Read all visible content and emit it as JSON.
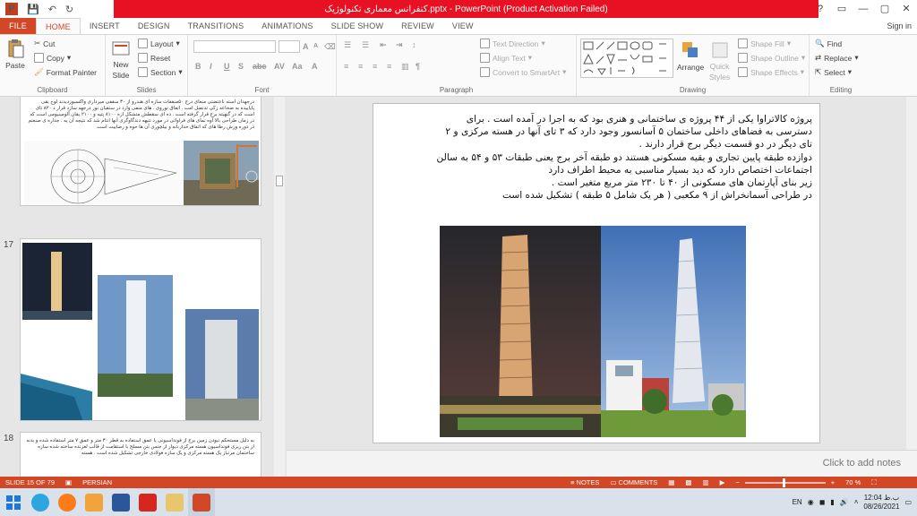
{
  "titlebar": {
    "title": "کنفرانس معماری تکنولوژیک.pptx - PowerPoint (Product Activation Failed)",
    "qat_save": "💾",
    "qat_undo": "↶",
    "qat_redo": "↻",
    "help": "?",
    "ribbon_opts": "▭",
    "minimize": "—",
    "maximize": "▢",
    "close": "✕"
  },
  "tabs": [
    "FILE",
    "HOME",
    "INSERT",
    "DESIGN",
    "TRANSITIONS",
    "ANIMATIONS",
    "SLIDE SHOW",
    "REVIEW",
    "VIEW"
  ],
  "signin": "Sign in",
  "ribbon": {
    "clipboard": {
      "label": "Clipboard",
      "paste": "Paste",
      "cut": "Cut",
      "copy": "Copy",
      "format_painter": "Format Painter"
    },
    "slides": {
      "label": "Slides",
      "new_slide": "New",
      "new_slide_2": "Slide",
      "layout": "Layout",
      "reset": "Reset",
      "section": "Section"
    },
    "font": {
      "label": "Font"
    },
    "paragraph": {
      "label": "Paragraph",
      "text_direction": "Text Direction",
      "align_text": "Align Text",
      "convert_smartart": "Convert to SmartArt"
    },
    "drawing": {
      "label": "Drawing",
      "arrange": "Arrange",
      "quick_styles": "Quick",
      "quick_styles_2": "Styles",
      "shape_fill": "Shape Fill",
      "shape_outline": "Shape Outline",
      "shape_effects": "Shape Effects"
    },
    "editing": {
      "label": "Editing",
      "find": "Find",
      "replace": "Replace",
      "select": "Select"
    }
  },
  "thumbs": {
    "slide16_text": "درجهدان استه ناعتضتی منعای درج ۵۰منقفات سازه ای هندرو از ۳۰ سقفی مبرداری واکسبوزدیدند لوح بقی پایاییده به ضخاعه زکی تدنضل امت . اتفاق توروی . های منفی وارد در ستقبان نور درجهه سازد قرار د ۸۲۰ تای است که در گنهبته برج قرار گرفته است . ده ای سقطش متشکل ازه ۸۱۰۰ پتیه و ۲۱۰۰ یقان آلومینیومی است که در زمان طراحی بالا آوه نمای های فراواتی در مورد تنبهه دندگاوگری آنها انتام شد که نتیجه آن یه . جداره ی صنعتم در دوره ورش رطا های که اتفاق حداربانه و بیلچوری آن ها حوه و رضاییت است",
    "slide17_num": "17",
    "slide18_num": "18",
    "slide18_text": "به دلیل مستحکم نبودن زمین برج از فونداسیونی با عمق استفاده به قطر ۳۰ متر و عمق ۷ متر استفاده شده و بدنه از بتن ریزی فونداسیون هسته مرکزی دیوار از جنس بتن مسلح با استقامت از قالب لغزنده ساخته شده سازه ساختمان مرتباز یک هسته مرکزی و یک سازه فولادی خارجی تشکیل شده است . هسته"
  },
  "slide": {
    "lines": [
      "پروژه کالاتراوا یکی از ۴۴ پروژه ی ساختمانی و هنری بود که به اجرا در آمده است . برای",
      "دسترسی به فضاهای داخلی ساختمان ۵ آسانسور وجود دارد که ۳ تای آنها در هسته مرکزی و ۲",
      "تای دیگر در دو قسمت دیگر برج قرار دارند .",
      "دوازده طبقه پایین تجاری و بقیه مسکونی هستند دو طبقه آخر برج یعنی طبقات ۵۳ و ۵۴ به سالن",
      "اجتماعات اختصاص دارد که دید بسیار مناسبی به محیط اطراف دارد",
      "زیر بنای آپارتمان های مسکونی از ۴۰ تا ۲۳۰ متر مربع متغیر است .",
      "در طراحی آسمانخراش از ۹ مکعبی ( هر یک شامل ۵ طبقه ) تشکیل شده است"
    ]
  },
  "notes_placeholder": "Click to add notes",
  "statusbar": {
    "slide": "SLIDE 15 OF 79",
    "language": "PERSIAN",
    "notes": "NOTES",
    "comments": "COMMENTS",
    "zoom": "70 %"
  },
  "taskbar": {
    "lang": "EN",
    "time": "12:04 ب.ظ",
    "date": "08/26/2021"
  },
  "colors": {
    "accent": "#d24726",
    "title_red": "#e81123"
  }
}
